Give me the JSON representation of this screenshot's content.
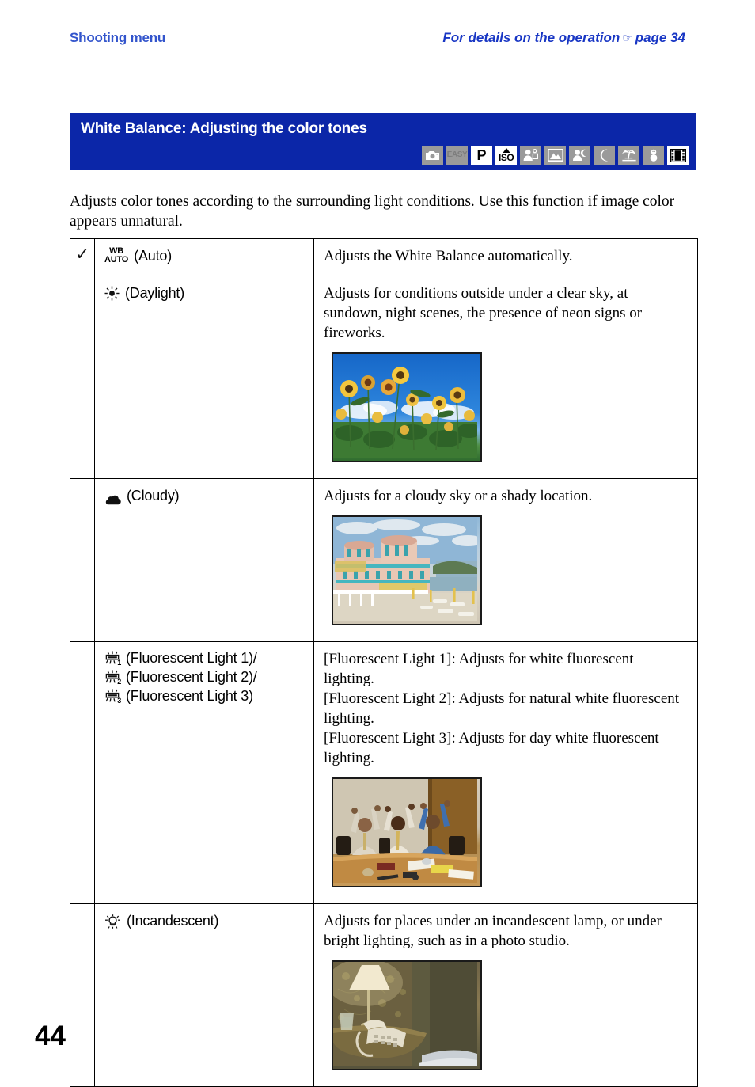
{
  "running_head": {
    "left": "Shooting menu",
    "right_prefix": "For details on the operation",
    "right_hand_icon": "pointing-hand-icon",
    "right_suffix": "page 34"
  },
  "title_band": {
    "title": "White Balance: Adjusting the color tones",
    "background_color": "#0B26A8",
    "title_color": "#ffffff",
    "mode_icons": [
      {
        "name": "still-camera-mode-icon",
        "label": "",
        "state": "dimmed"
      },
      {
        "name": "easy-mode-icon",
        "label": "EASY",
        "state": "dimmed"
      },
      {
        "name": "program-auto-mode-icon",
        "label": "P",
        "state": "active"
      },
      {
        "name": "high-sensitivity-iso-mode-icon",
        "label": "ISO",
        "state": "active"
      },
      {
        "name": "soft-snap-mode-icon",
        "label": "",
        "state": "dimmed"
      },
      {
        "name": "landscape-mode-icon",
        "label": "",
        "state": "dimmed"
      },
      {
        "name": "twilight-portrait-mode-icon",
        "label": "",
        "state": "dimmed"
      },
      {
        "name": "twilight-mode-icon",
        "label": "",
        "state": "dimmed"
      },
      {
        "name": "beach-mode-icon",
        "label": "",
        "state": "dimmed"
      },
      {
        "name": "snow-mode-icon",
        "label": "",
        "state": "dimmed"
      },
      {
        "name": "movie-mode-icon",
        "label": "",
        "state": "active"
      }
    ]
  },
  "intro": "Adjusts color tones according to the surrounding light conditions. Use this function if image color appears unnatural.",
  "table": {
    "rows": [
      {
        "checked": true,
        "check_glyph": "✓",
        "icon": "wb-auto-icon",
        "icon_text_top": "WB",
        "icon_text_bottom": "AUTO",
        "label": "(Auto)",
        "description": [
          "Adjusts the White Balance automatically."
        ],
        "photo": null
      },
      {
        "checked": false,
        "check_glyph": "",
        "icon": "sun-daylight-icon",
        "label": "(Daylight)",
        "description": [
          "Adjusts for conditions outside under a clear sky, at sundown, night scenes, the presence of neon signs or fireworks."
        ],
        "photo": {
          "name": "sunflower-field-photo",
          "alt": "Sunflower field against a blue sky with clouds"
        }
      },
      {
        "checked": false,
        "check_glyph": "",
        "icon": "cloud-cloudy-icon",
        "label": "(Cloudy)",
        "description": [
          "Adjusts for a cloudy sky or a shady location."
        ],
        "photo": {
          "name": "seaside-resort-photo",
          "alt": "Pink seaside resort hotel with parasols under a cloudy sky"
        }
      },
      {
        "checked": false,
        "check_glyph": "",
        "icon": "fluorescent-light-icon",
        "multi_labels": [
          {
            "icon": "fluorescent-light-1-icon",
            "subscript": "1",
            "label": "(Fluorescent Light 1)/"
          },
          {
            "icon": "fluorescent-light-2-icon",
            "subscript": "2",
            "label": "(Fluorescent Light 2)/"
          },
          {
            "icon": "fluorescent-light-3-icon",
            "subscript": "3",
            "label": "(Fluorescent Light 3)"
          }
        ],
        "description": [
          "[Fluorescent Light 1]: Adjusts for white fluorescent lighting.",
          "[Fluorescent Light 2]: Adjusts for natural white fluorescent lighting.",
          "[Fluorescent Light 3]: Adjusts for day white fluorescent lighting."
        ],
        "photo": {
          "name": "office-celebration-photo",
          "alt": "Three men cheering with raised arms at a conference table"
        }
      },
      {
        "checked": false,
        "check_glyph": "",
        "icon": "incandescent-bulb-icon",
        "label": "(Incandescent)",
        "description": [
          "Adjusts for places under an incandescent lamp, or under bright lighting, such as in a photo studio."
        ],
        "photo": {
          "name": "bedside-lamp-photo",
          "alt": "Bedside table with lit lamp and telephone in warm light"
        }
      }
    ]
  },
  "page_number": "44"
}
